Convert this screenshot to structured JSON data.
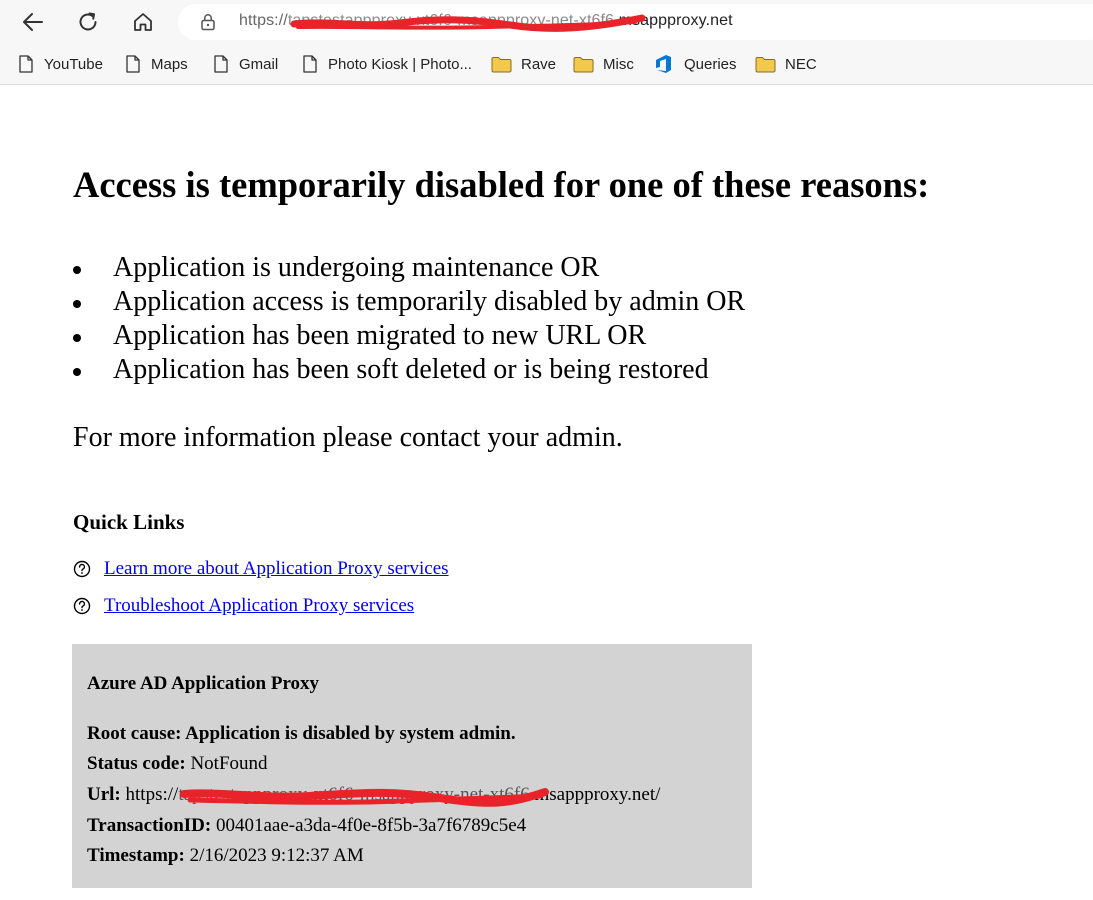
{
  "browser": {
    "url": {
      "scheme": "https://",
      "redacted": "tapstestappproxy-xt6f6-msappproxy-net-xt6f6.",
      "host": "msappproxy.net"
    },
    "bookmarks": [
      {
        "label": "YouTube",
        "icon": "page-icon"
      },
      {
        "label": "Maps",
        "icon": "page-icon"
      },
      {
        "label": "Gmail",
        "icon": "page-icon"
      },
      {
        "label": "Photo Kiosk | Photo...",
        "icon": "page-icon"
      },
      {
        "label": "Rave",
        "icon": "folder-icon"
      },
      {
        "label": "Misc",
        "icon": "folder-icon"
      },
      {
        "label": "Queries",
        "icon": "azure-devops-icon"
      },
      {
        "label": "NEC",
        "icon": "folder-icon"
      }
    ],
    "colors": {
      "redaction": "#e8242a",
      "folder": "#f2c94c",
      "azure": "#0078d4"
    }
  },
  "page": {
    "title": "Access is temporarily disabled for one of these reasons:",
    "reasons": [
      "Application is undergoing maintenance OR",
      "Application access is temporarily disabled by admin OR",
      "Application has been migrated to new URL OR",
      "Application has been soft deleted or is being restored"
    ],
    "more_info": "For more information please contact your admin.",
    "quick_links": {
      "title": "Quick Links",
      "links": [
        {
          "label": "Learn more about Application Proxy services",
          "icon": "help-circle-icon"
        },
        {
          "label": "Troubleshoot Application Proxy services",
          "icon": "help-circle-icon"
        }
      ]
    },
    "details": {
      "title": "Azure AD Application Proxy",
      "root_cause": "Root cause: Application is disabled by system admin.",
      "status_code_label": "Status code:",
      "status_code_value": "NotFound",
      "url_label": "Url:",
      "url_scheme": "https://",
      "url_redacted": "tapstestappproxy-xt6f6-msappproxy-net-xt6f6.",
      "url_host": "msappproxy.net/",
      "transaction_label": "TransactionID:",
      "transaction_value": "00401aae-a3da-4f0e-8f5b-3a7f6789c5e4",
      "timestamp_label": "Timestamp:",
      "timestamp_value": "2/16/2023 9:12:37 AM",
      "background": "#d3d3d3"
    },
    "link_color": "#0000ee"
  }
}
